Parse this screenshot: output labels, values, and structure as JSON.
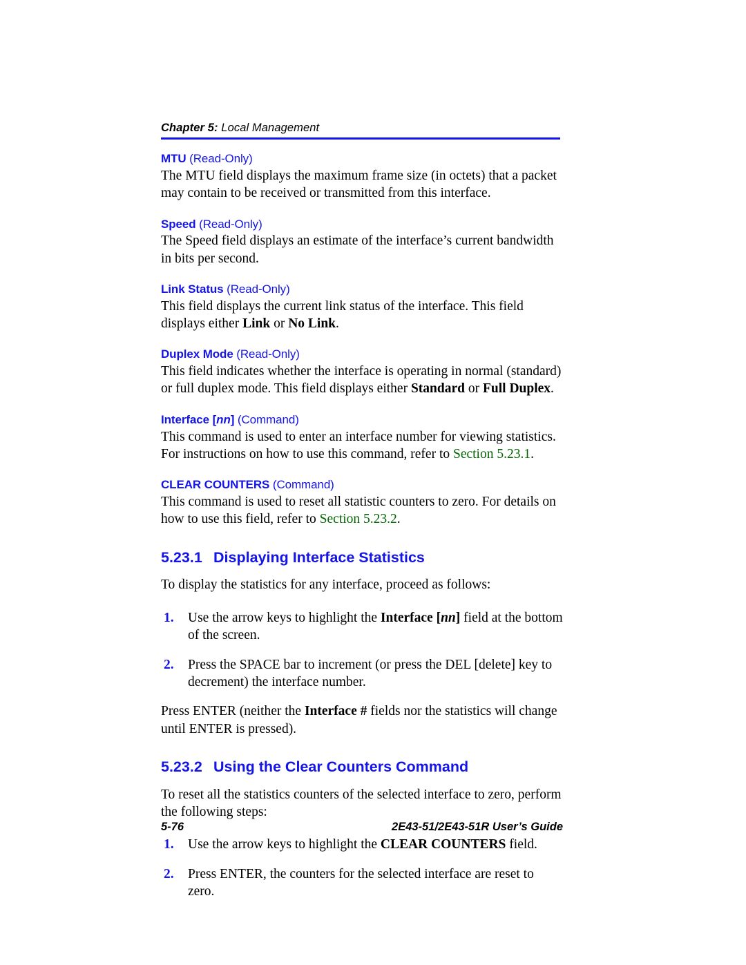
{
  "header": {
    "chapter_label": "Chapter 5:",
    "chapter_title": " Local Management",
    "rule_color": "#1414e6"
  },
  "colors": {
    "heading_blue": "#1414e6",
    "xref_green": "#046604",
    "body_black": "#000000"
  },
  "fields": [
    {
      "name": "MTU",
      "kind": " (Read-Only)",
      "body_pre": "The MTU field displays the maximum frame size (in octets) that a packet may contain to be received or transmitted from this interface."
    },
    {
      "name": "Speed",
      "kind": " (Read-Only)",
      "body_pre": "The Speed field displays an estimate of the interface’s current bandwidth in bits per second."
    },
    {
      "name": "Link Status",
      "kind": " (Read-Only)",
      "body_pre": "This field displays the current link status of the interface. This field displays either ",
      "bold_1": "Link",
      "body_mid": " or ",
      "bold_2": "No Link",
      "body_post": "."
    },
    {
      "name": "Duplex Mode",
      "kind": " (Read-Only)",
      "body_pre": "This field indicates whether the interface is operating in normal (standard) or full duplex mode. This field displays either ",
      "bold_1": "Standard",
      "body_mid": " or ",
      "bold_2": "Full Duplex",
      "body_post": "."
    },
    {
      "name_pre": "Interface [",
      "name_italic": "nn",
      "name_post": "]",
      "kind": " (Command)",
      "body_pre": "This command is used to enter an interface number for viewing statistics. For instructions on how to use this command, refer to ",
      "xref": "Section 5.23.1",
      "body_post": "."
    },
    {
      "name": "CLEAR COUNTERS",
      "kind": " (Command)",
      "body_pre": "This command is used to reset all statistic counters to zero. For details on how to use this field, refer to ",
      "xref": "Section 5.23.2",
      "body_post": "."
    }
  ],
  "section_1": {
    "number": "5.23.1",
    "title": "Displaying Interface Statistics",
    "intro": "To display the statistics for any interface, proceed as follows:",
    "steps": [
      {
        "marker": "1.",
        "text_pre": "Use the arrow keys to highlight the ",
        "bold_pre": "Interface [",
        "bold_italic": "nn",
        "bold_post": "]",
        "text_post": " field at the bottom of the screen."
      },
      {
        "marker": "2.",
        "text_pre": "Press the SPACE bar to increment (or press the DEL [delete] key to decrement) the interface number.",
        "bold_pre": "",
        "bold_italic": "",
        "bold_post": "",
        "text_post": ""
      }
    ],
    "closing_pre": "Press ENTER (neither the ",
    "closing_bold": "Interface #",
    "closing_post": " fields nor the statistics will change until ENTER is pressed)."
  },
  "section_2": {
    "number": "5.23.2",
    "title": "Using the Clear Counters Command",
    "intro": "To reset all the statistics counters of the selected interface to zero, perform the following steps:",
    "steps": [
      {
        "marker": "1.",
        "text_pre": "Use the arrow keys to highlight the ",
        "bold": "CLEAR COUNTERS",
        "text_post": " field."
      },
      {
        "marker": "2.",
        "text_pre": "Press ENTER, the counters for the selected interface are reset to zero.",
        "bold": "",
        "text_post": ""
      }
    ]
  },
  "footer": {
    "page_number": "5-76",
    "guide_title": "2E43-51/2E43-51R User’s Guide"
  }
}
